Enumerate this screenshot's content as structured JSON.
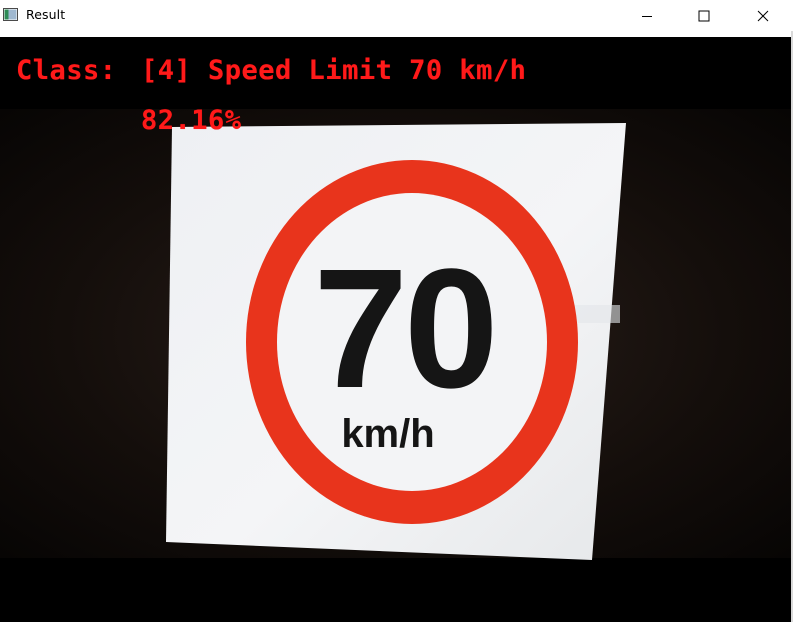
{
  "window": {
    "title": "Result",
    "controls": {
      "minimize_icon": "minimize-icon",
      "maximize_icon": "maximize-icon",
      "close_icon": "close-icon"
    }
  },
  "overlay": {
    "class_label": "Class:",
    "class_value": "[4] Speed Limit 70 km/h",
    "probability": "82.16%",
    "color": "#ff1a1a"
  },
  "sign": {
    "number": "70",
    "unit": "km/h",
    "ring_color": "#e8341c",
    "background_color": "#f2f3f5"
  }
}
